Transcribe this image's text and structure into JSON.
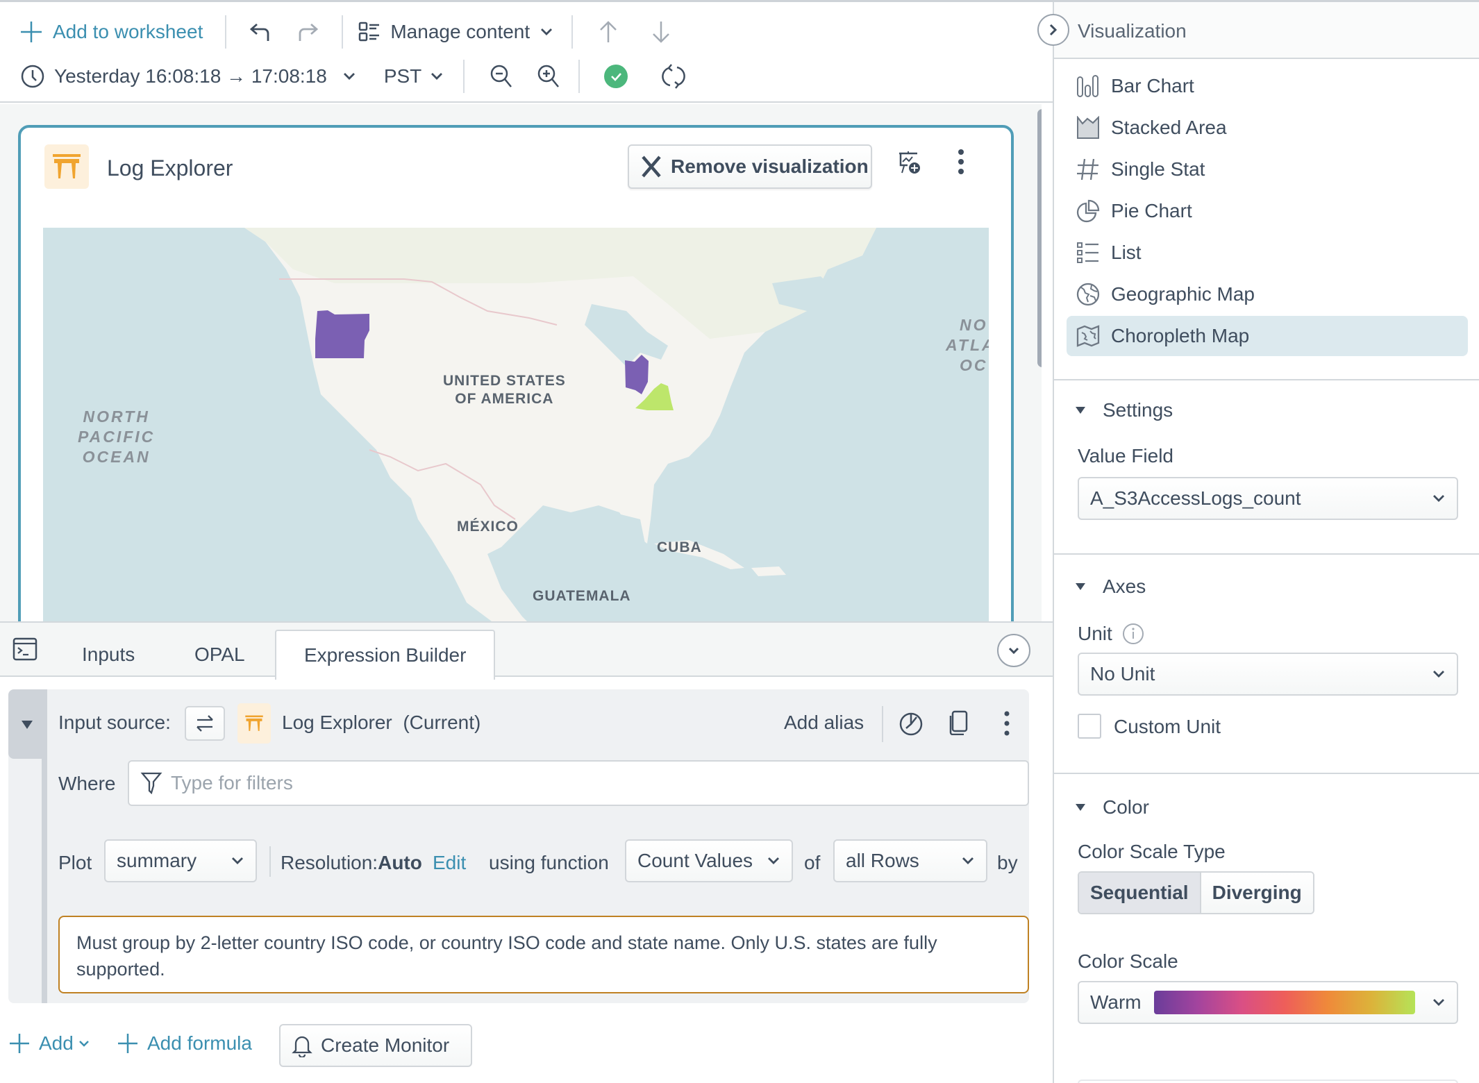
{
  "toolbar": {
    "add_to_worksheet": "Add to worksheet",
    "manage_content": "Manage content",
    "time_range": "Yesterday 16:08:18 → 17:08:18",
    "timezone": "PST"
  },
  "card": {
    "title": "Log Explorer",
    "remove_visualization": "Remove visualization"
  },
  "map": {
    "labels": {
      "usa_line1": "UNITED STATES",
      "usa_line2": "OF AMERICA",
      "mexico": "MÉXICO",
      "cuba": "CUBA",
      "guatemala": "GUATEMALA",
      "pacific_1": "NORTH",
      "pacific_2": "PACIFIC",
      "pacific_3": "OCEAN",
      "atlantic_1": "NO",
      "atlantic_2": "ATLA",
      "atlantic_3": "OC"
    },
    "highlighted_regions": [
      {
        "name": "Oregon",
        "color": "#7b60b3"
      },
      {
        "name": "Ohio",
        "color": "#7b60b3"
      },
      {
        "name": "Virginia",
        "color": "#bde66b"
      }
    ]
  },
  "editor": {
    "tabs": [
      {
        "label": "Inputs",
        "active": false
      },
      {
        "label": "OPAL",
        "active": false
      },
      {
        "label": "Expression Builder",
        "active": true
      }
    ],
    "input_source_label": "Input source:",
    "input_source_name": "Log Explorer",
    "input_source_suffix": "(Current)",
    "add_alias": "Add alias",
    "where_label": "Where",
    "where_placeholder": "Type for filters",
    "where_value": "",
    "plot_label": "Plot",
    "plot_value": "summary",
    "resolution_label": "Resolution:",
    "resolution_value": "Auto",
    "resolution_edit": "Edit",
    "using_function_label": "using function",
    "function_value": "Count Values",
    "of_label": "of",
    "of_value": "all Rows",
    "by_label": "by",
    "warning": "Must group by 2-letter country ISO code, or country ISO code and state name. Only U.S. states are fully supported.",
    "add": "Add",
    "add_formula": "Add formula",
    "create_monitor": "Create Monitor"
  },
  "sidebar": {
    "title": "Visualization",
    "viz_types": [
      {
        "label": "Bar Chart",
        "icon": "bar-chart-icon",
        "selected": false
      },
      {
        "label": "Stacked Area",
        "icon": "stacked-area-icon",
        "selected": false
      },
      {
        "label": "Single Stat",
        "icon": "hash-icon",
        "selected": false
      },
      {
        "label": "Pie Chart",
        "icon": "pie-chart-icon",
        "selected": false
      },
      {
        "label": "List",
        "icon": "list-icon",
        "selected": false
      },
      {
        "label": "Geographic Map",
        "icon": "globe-icon",
        "selected": false
      },
      {
        "label": "Choropleth Map",
        "icon": "map-icon",
        "selected": true
      }
    ],
    "settings": {
      "title": "Settings",
      "value_field_label": "Value Field",
      "value_field": "A_S3AccessLogs_count"
    },
    "axes": {
      "title": "Axes",
      "unit_label": "Unit",
      "unit_value": "No Unit",
      "custom_unit_label": "Custom Unit",
      "custom_unit_checked": false
    },
    "color": {
      "title": "Color",
      "scale_type_label": "Color Scale Type",
      "scale_types": [
        "Sequential",
        "Diverging"
      ],
      "scale_type_selected": "Sequential",
      "scale_label": "Color Scale",
      "scale_value": "Warm",
      "scale_gradient": [
        "#6a3d9a",
        "#a3449e",
        "#d94f85",
        "#ee5e5a",
        "#ef8a3a",
        "#dcb33a",
        "#b5e358"
      ]
    }
  },
  "colors": {
    "accent": "#3b8fb0",
    "card_border": "#509db7",
    "success": "#4cb77c",
    "warning_border": "#bf8123"
  }
}
